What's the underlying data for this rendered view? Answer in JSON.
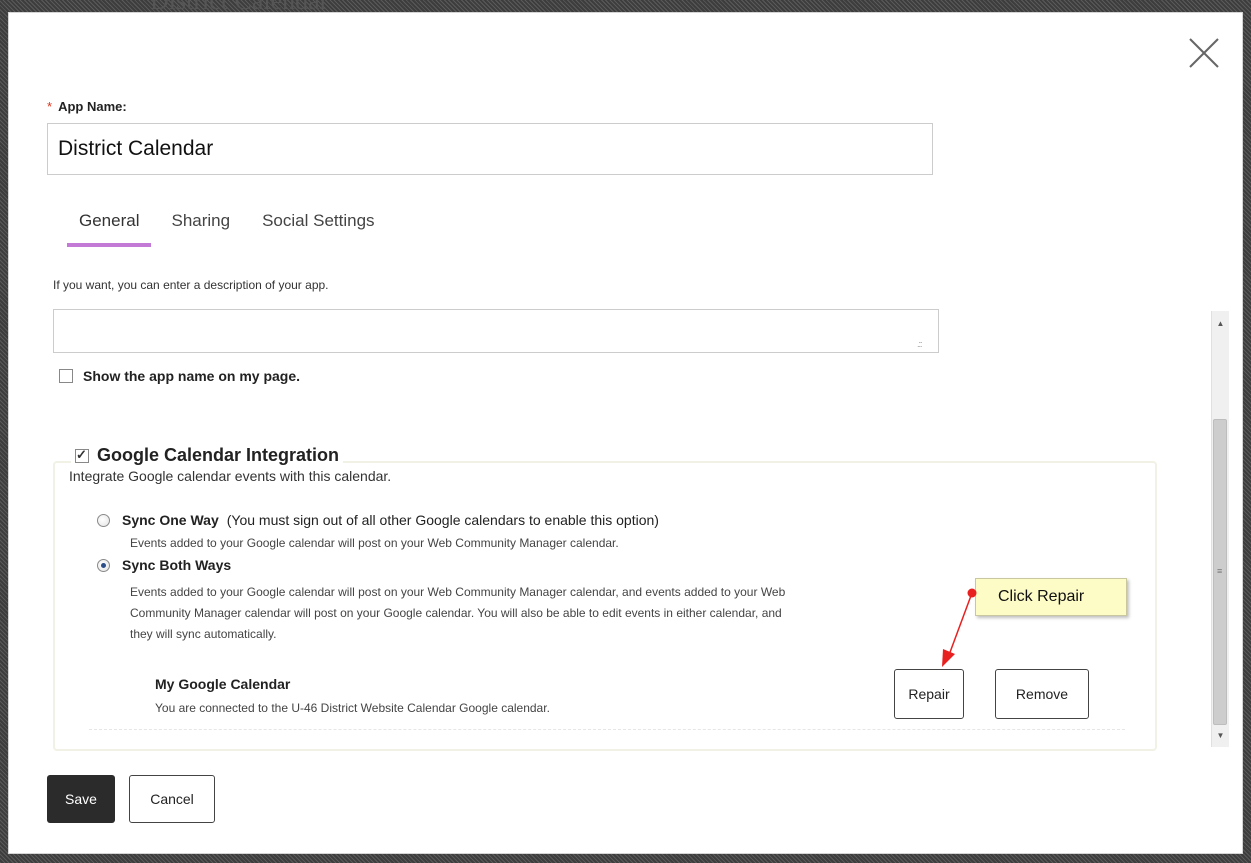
{
  "backdrop": {
    "title": "District Calendar"
  },
  "form": {
    "app_name_label": "App Name:",
    "required_mark": "*",
    "app_name_value": "District Calendar"
  },
  "tabs": [
    {
      "label": "General",
      "active": true
    },
    {
      "label": "Sharing",
      "active": false
    },
    {
      "label": "Social Settings",
      "active": false
    }
  ],
  "general": {
    "description_hint": "If you want, you can enter a description of your app.",
    "description_value": "",
    "show_name_label": "Show the app name on my page.",
    "show_name_checked": false
  },
  "google_integration": {
    "label": "Google Calendar Integration",
    "checked": true,
    "description": "Integrate Google calendar events with this calendar.",
    "options": [
      {
        "title": "Sync One Way",
        "note": "(You must sign out of all other Google calendars to enable this option)",
        "description": "Events added to your Google calendar will post on your Web Community Manager calendar.",
        "selected": false
      },
      {
        "title": "Sync Both Ways",
        "note": "",
        "description_lines": [
          "Events added to your Google calendar will post on your Web Community Manager calendar, and events added to your Web",
          "Community Manager calendar will post on your Google calendar. You will also be able to edit events in either calendar, and",
          "they will sync automatically."
        ],
        "selected": true
      }
    ],
    "connection": {
      "title": "My Google Calendar",
      "status": "You are connected to the U-46 District Website Calendar Google calendar.",
      "repair_label": "Repair",
      "remove_label": "Remove"
    }
  },
  "callout": {
    "text": "Click Repair",
    "color": "#fdfcc6",
    "arrow_color": "#e8201f"
  },
  "footer": {
    "save_label": "Save",
    "cancel_label": "Cancel"
  },
  "icons": {
    "close": "close-icon",
    "scroll_up": "▲",
    "scroll_down": "▼",
    "grip": "≡"
  },
  "colors": {
    "accent_tab": "#c37ad6",
    "required": "#e0331a",
    "save_bg": "#2b2b2b"
  }
}
